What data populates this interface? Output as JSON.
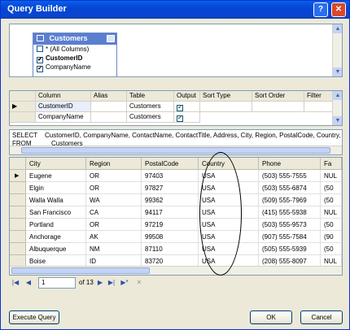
{
  "window": {
    "title": "Query Builder",
    "help_label": "?",
    "close_label": "✕"
  },
  "diagram": {
    "table_name": "Customers",
    "columns": [
      {
        "label": "* (All Columns)",
        "checked": false
      },
      {
        "label": "CustomerID",
        "checked": true
      },
      {
        "label": "CompanyName",
        "checked": true
      }
    ]
  },
  "criteria": {
    "headers": [
      "Column",
      "Alias",
      "Table",
      "Output",
      "Sort Type",
      "Sort Order",
      "Filter"
    ],
    "rows": [
      {
        "column": "CustomerID",
        "alias": "",
        "table": "Customers",
        "output": true
      },
      {
        "column": "CompanyName",
        "alias": "",
        "table": "Customers",
        "output": true
      }
    ]
  },
  "sql": {
    "line1_keyword": "SELECT",
    "line1_text": "CustomerID, CompanyName, ContactName, ContactTitle, Address, City, Region, PostalCode, Country, Pho",
    "line2_keyword": "FROM",
    "line2_text": "Customers"
  },
  "results": {
    "headers": [
      "City",
      "Region",
      "PostalCode",
      "Country",
      "Phone",
      "Fa"
    ],
    "rows": [
      [
        "Eugene",
        "OR",
        "97403",
        "USA",
        "(503) 555-7555",
        "NUL"
      ],
      [
        "Elgin",
        "OR",
        "97827",
        "USA",
        "(503) 555-6874",
        "(50"
      ],
      [
        "Walla Walla",
        "WA",
        "99362",
        "USA",
        "(509) 555-7969",
        "(50"
      ],
      [
        "San Francisco",
        "CA",
        "94117",
        "USA",
        "(415) 555-5938",
        "NUL"
      ],
      [
        "Portland",
        "OR",
        "97219",
        "USA",
        "(503) 555-9573",
        "(50"
      ],
      [
        "Anchorage",
        "AK",
        "99508",
        "USA",
        "(907) 555-7584",
        "(90"
      ],
      [
        "Albuquerque",
        "NM",
        "87110",
        "USA",
        "(505) 555-5939",
        "(50"
      ],
      [
        "Boise",
        "ID",
        "83720",
        "USA",
        "(208) 555-8097",
        "NUL"
      ]
    ]
  },
  "navigator": {
    "position": "1",
    "total_label": "of 13"
  },
  "buttons": {
    "execute": "Execute Query",
    "ok": "OK",
    "cancel": "Cancel"
  }
}
